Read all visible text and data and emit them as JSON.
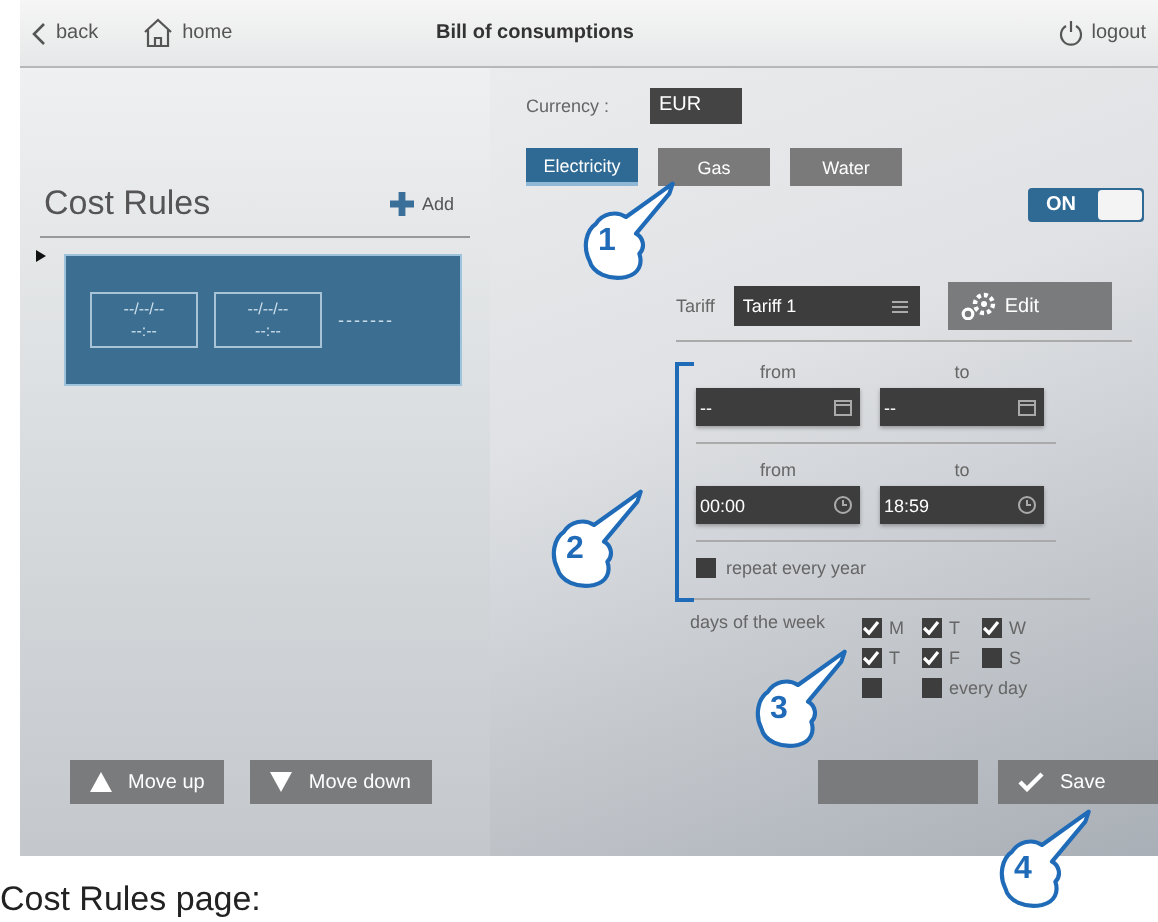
{
  "header": {
    "back": "back",
    "home": "home",
    "title": "Bill of consumptions",
    "logout": "logout"
  },
  "cost_rules": {
    "title": "Cost Rules",
    "add": "Add",
    "rules": [
      {
        "selected": true,
        "date_1": "--/--/--",
        "time_1": "--:--",
        "date_2": "--/--/--",
        "time_2": "--:--",
        "more": "-------"
      }
    ],
    "buttons": [
      "Move up",
      "Move down"
    ]
  },
  "currency": {
    "label": "Currency :",
    "value": "EUR"
  },
  "tabs": [
    {
      "label": "Electricity",
      "selected": true
    },
    {
      "label": "Gas",
      "selected": false
    },
    {
      "label": "Water",
      "selected": false
    }
  ],
  "toggle": {
    "label": "ON",
    "on": true
  },
  "tariff": {
    "label": "Tariff",
    "value": "Tariff 1",
    "edit": "Edit"
  },
  "date_range": {
    "from_label": "from",
    "to_label": "to",
    "from": "--",
    "to": "--"
  },
  "time_range": {
    "from_label": "from",
    "to_label": "to",
    "from": "00:00",
    "to": "18:59"
  },
  "repeat": {
    "label": "repeat every year",
    "checked": false
  },
  "days": {
    "label": "days of the week",
    "items": [
      {
        "label": "M",
        "checked": true
      },
      {
        "label": "T",
        "checked": true
      },
      {
        "label": "W",
        "checked": true
      },
      {
        "label": "T",
        "checked": true
      },
      {
        "label": "F",
        "checked": true
      },
      {
        "label": "S",
        "checked": false
      },
      {
        "checked": false
      },
      {
        "label": "every day",
        "checked": false
      }
    ]
  },
  "actions": [
    {
      "kind": "covered"
    },
    {
      "kind": "save",
      "label": "Save"
    }
  ],
  "callouts": [
    {
      "number": "1"
    },
    {
      "number": "2"
    },
    {
      "number": "3"
    },
    {
      "number": "4"
    }
  ],
  "caption": "Cost Rules page:"
}
